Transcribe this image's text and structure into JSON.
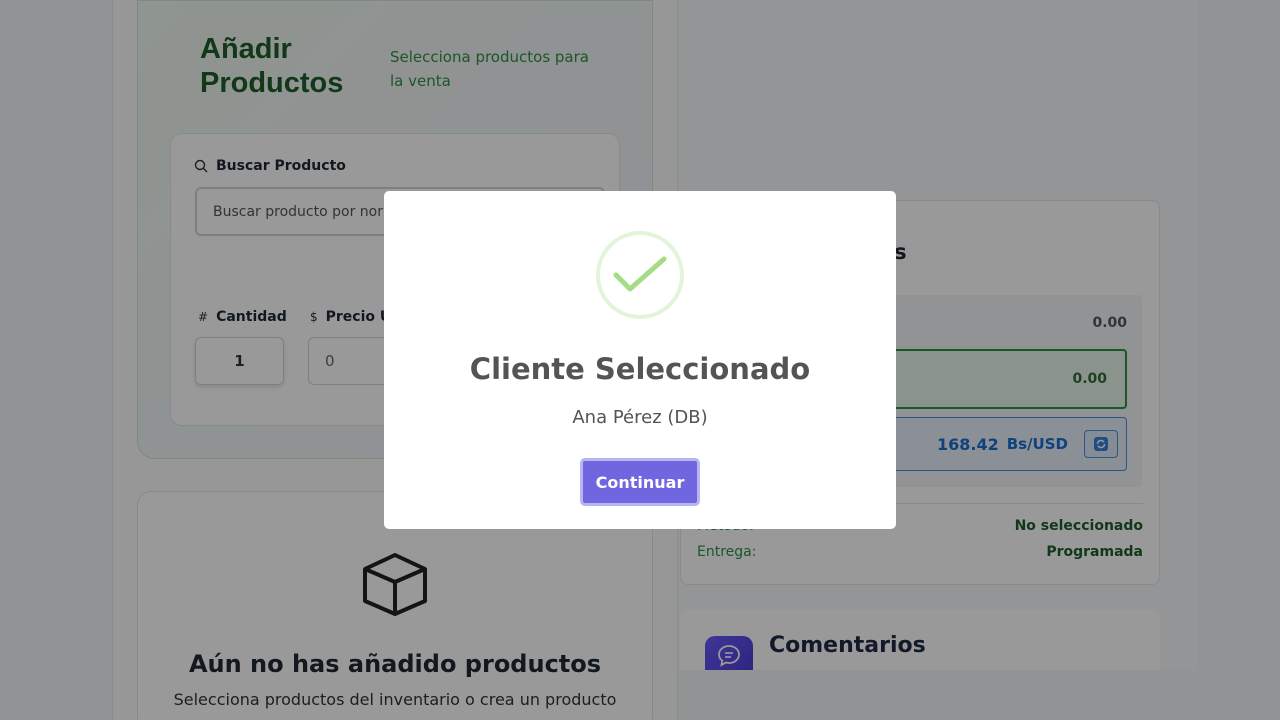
{
  "add_products": {
    "title": "Añadir Productos",
    "subtitle": "Selecciona productos para la venta",
    "search_label": "Buscar Producto",
    "search_placeholder": "Buscar producto por nor",
    "quantity_symbol": "#",
    "quantity_label": "Cantidad",
    "quantity_value": "1",
    "price_symbol": "$",
    "price_label": "Precio U",
    "price_value": "0"
  },
  "empty_state": {
    "icon": "box-icon",
    "title": "Aún no has añadido productos",
    "subtitle": "Selecciona productos del inventario o crea un producto"
  },
  "summary": {
    "title_fragment": "as",
    "subtotal_value": "0.00",
    "total_value": "0.00",
    "exchange_rate": "168.42",
    "exchange_unit": "Bs/USD",
    "method_label": "Método:",
    "method_value": "No seleccionado",
    "delivery_label": "Entrega:",
    "delivery_value": "Programada"
  },
  "comments": {
    "title": "Comentarios"
  },
  "modal": {
    "icon": "success-check-icon",
    "title": "Cliente Seleccionado",
    "text": "Ana Pérez (DB)",
    "confirm_label": "Continuar",
    "colors": {
      "confirm": "#7066e0",
      "check": "#a5dc86"
    }
  }
}
